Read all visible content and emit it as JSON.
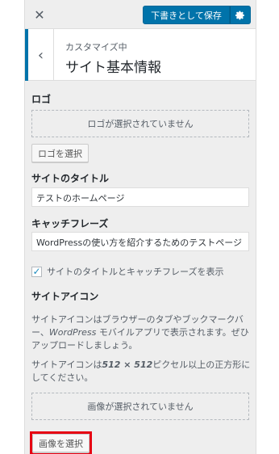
{
  "header": {
    "close_icon": "close-icon",
    "save_label": "下書きとして保存",
    "gear_icon": "gear-icon",
    "accent": "#0073aa"
  },
  "section": {
    "customizing_label": "カスタマイズ中",
    "title": "サイト基本情報",
    "back_icon": "chevron-left-icon"
  },
  "logo": {
    "label": "ロゴ",
    "placeholder": "ロゴが選択されていません",
    "select_button": "ロゴを選択"
  },
  "site_title": {
    "label": "サイトのタイトル",
    "value": "テストのホームページ"
  },
  "tagline": {
    "label": "キャッチフレーズ",
    "value": "WordPressの使い方を紹介するためのテストページ"
  },
  "display_checkbox": {
    "checked": true,
    "label": "サイトのタイトルとキャッチフレーズを表示"
  },
  "site_icon": {
    "label": "サイトアイコン",
    "desc1_pre": "サイトアイコンはブラウザーのタブやブックマークバー、",
    "desc1_em": "WordPress",
    "desc1_post": " モバイルアプリで表示されます。ぜひアップロードしましょう。",
    "desc2_pre": "サイトアイコンは",
    "desc2_size": "512 × 512",
    "desc2_post": "ピクセル以上の正方形にしてください。",
    "placeholder": "画像が選択されていません",
    "select_button": "画像を選択",
    "highlight_color": "#e60012"
  }
}
